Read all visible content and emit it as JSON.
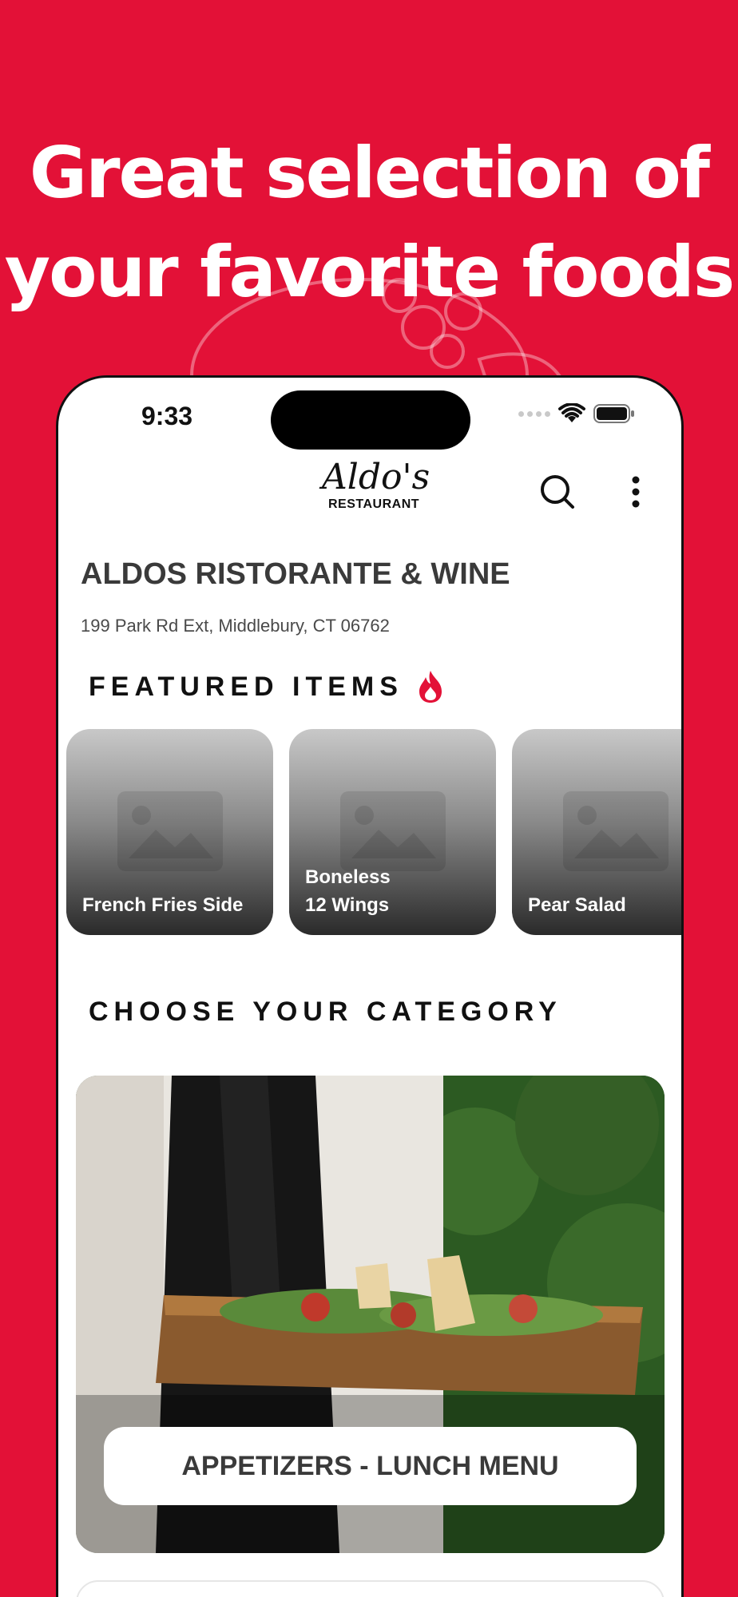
{
  "hero": {
    "line1": "Great selection of",
    "line2": "your favorite foods"
  },
  "status_bar": {
    "time": "9:33"
  },
  "header": {
    "logo_script": "Aldo's",
    "logo_sub": "RESTAURANT",
    "search_icon": "search-icon",
    "menu_icon": "more-vertical-icon"
  },
  "restaurant": {
    "name": "ALDOS RISTORANTE & WINE",
    "address": "199 Park Rd Ext, Middlebury, CT 06762"
  },
  "featured": {
    "title": "FEATURED ITEMS",
    "icon": "flame-icon",
    "items": [
      {
        "label": "French Fries Side"
      },
      {
        "label_line1": "Boneless",
        "label_line2": "12 Wings"
      },
      {
        "label": "Pear Salad"
      }
    ]
  },
  "category": {
    "title": "CHOOSE YOUR CATEGORY",
    "items": [
      {
        "label": "APPETIZERS - LUNCH MENU"
      }
    ]
  },
  "colors": {
    "brand": "#e31137",
    "text_dark": "#111111",
    "text_gray": "#3a3a3a"
  }
}
